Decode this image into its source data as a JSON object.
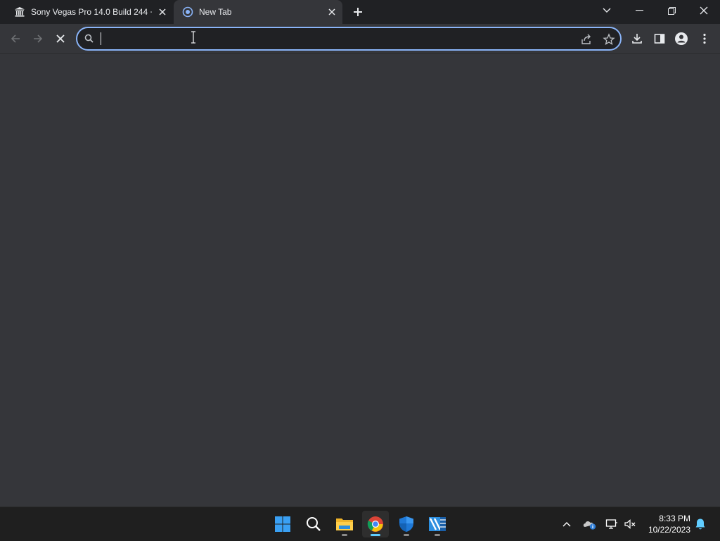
{
  "tabs": [
    {
      "title": "Sony Vegas Pro 14.0 Build 244 +",
      "icon": "bank-icon",
      "active": false
    },
    {
      "title": "New Tab",
      "icon": "chrome-loading-icon",
      "active": true
    }
  ],
  "omnibox": {
    "value": "",
    "placeholder": ""
  },
  "taskbar": {
    "apps": [
      "windows-start",
      "search",
      "file-explorer",
      "chrome",
      "windows-security",
      "video-editor"
    ],
    "active_app": "chrome"
  },
  "clock": {
    "time": "8:33 PM",
    "date": "10/22/2023"
  },
  "colors": {
    "accent": "#8ab4f8",
    "tabstrip": "#202124",
    "toolbar": "#35363a",
    "taskbar": "#1f1f1f",
    "taskbar_active": "#60cdff"
  }
}
